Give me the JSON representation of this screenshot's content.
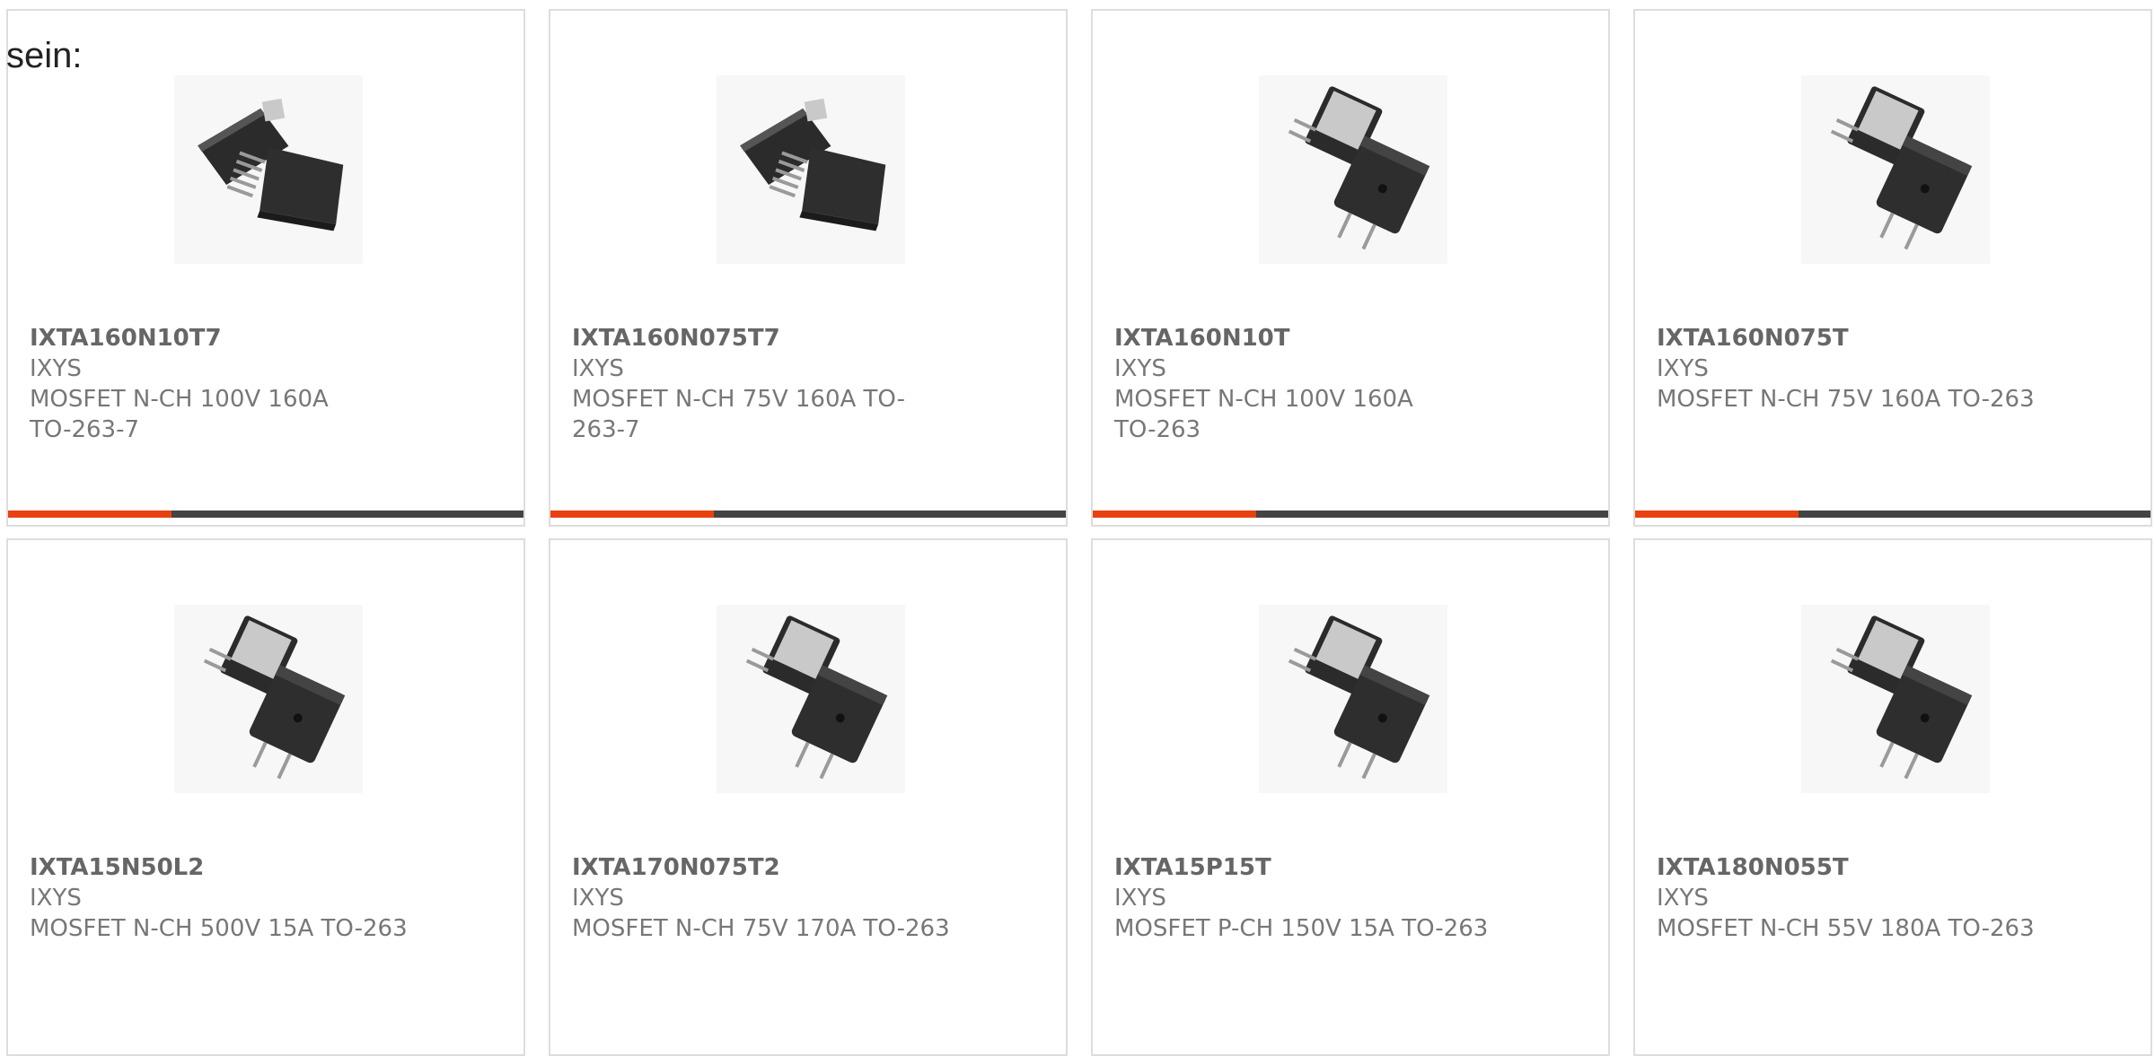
{
  "intro_text": "sein:",
  "colors": {
    "accent": "#e8410f",
    "bar": "#444444",
    "border": "#dddddd",
    "text": "#777777"
  },
  "products": [
    {
      "part_number": "IXTA160N10T7",
      "manufacturer": "IXYS",
      "description": "MOSFET N-CH 100V 160A TO-263-7",
      "image": "to263-7-package-icon",
      "hover_bar": true
    },
    {
      "part_number": "IXTA160N075T7",
      "manufacturer": "IXYS",
      "description": "MOSFET N-CH 75V 160A TO-263-7",
      "image": "to263-7-package-icon",
      "hover_bar": true
    },
    {
      "part_number": "IXTA160N10T",
      "manufacturer": "IXYS",
      "description": "MOSFET N-CH 100V 160A TO-263",
      "image": "to263-package-icon",
      "hover_bar": true
    },
    {
      "part_number": "IXTA160N075T",
      "manufacturer": "IXYS",
      "description": "MOSFET N-CH 75V 160A TO-263",
      "image": "to263-package-icon",
      "hover_bar": true
    },
    {
      "part_number": "IXTA15N50L2",
      "manufacturer": "IXYS",
      "description": "MOSFET N-CH 500V 15A TO-263",
      "image": "to263-package-icon",
      "hover_bar": false
    },
    {
      "part_number": "IXTA170N075T2",
      "manufacturer": "IXYS",
      "description": "MOSFET N-CH 75V 170A TO-263",
      "image": "to263-package-icon",
      "hover_bar": false
    },
    {
      "part_number": "IXTA15P15T",
      "manufacturer": "IXYS",
      "description": "MOSFET P-CH 150V 15A TO-263",
      "image": "to263-package-icon",
      "hover_bar": false
    },
    {
      "part_number": "IXTA180N055T",
      "manufacturer": "IXYS",
      "description": "MOSFET N-CH 55V 180A TO-263",
      "image": "to263-package-icon",
      "hover_bar": false
    }
  ]
}
